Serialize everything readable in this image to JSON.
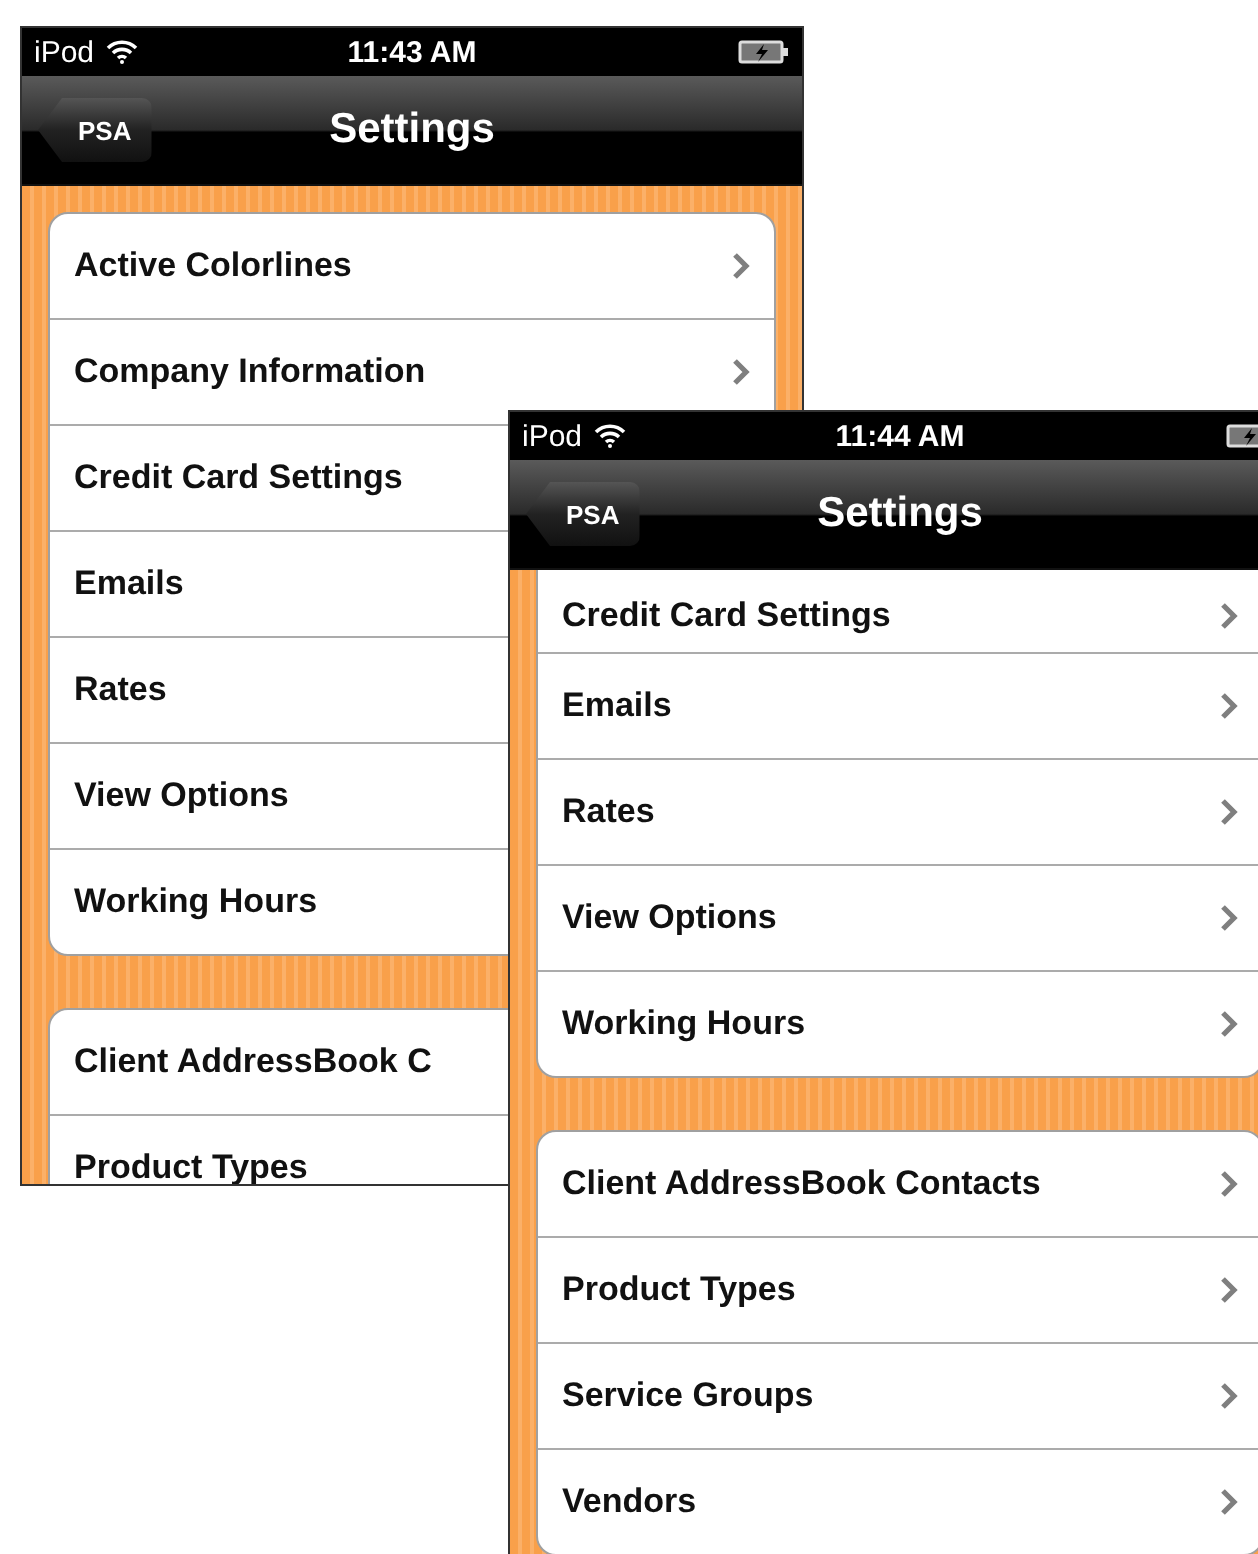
{
  "screens": [
    {
      "status_bar": {
        "carrier": "iPod",
        "time": "11:43 AM"
      },
      "nav_bar": {
        "back": "PSA",
        "title": "Settings"
      },
      "groups": [
        {
          "rows": [
            {
              "label": "Active Colorlines",
              "chevron": true
            },
            {
              "label": "Company Information",
              "chevron": true
            },
            {
              "label": "Credit Card Settings",
              "chevron": false
            },
            {
              "label": "Emails",
              "chevron": false
            },
            {
              "label": "Rates",
              "chevron": false
            },
            {
              "label": "View Options",
              "chevron": false
            },
            {
              "label": "Working Hours",
              "chevron": false
            }
          ]
        },
        {
          "rows": [
            {
              "label": "Client AddressBook C",
              "chevron": false
            },
            {
              "label": "Product Types",
              "chevron": false
            }
          ]
        }
      ]
    },
    {
      "status_bar": {
        "carrier": "iPod",
        "time": "11:44 AM"
      },
      "nav_bar": {
        "back": "PSA",
        "title": "Settings"
      },
      "groups": [
        {
          "rows": [
            {
              "label": "Credit Card Settings",
              "chevron": true
            },
            {
              "label": "Emails",
              "chevron": true
            },
            {
              "label": "Rates",
              "chevron": true
            },
            {
              "label": "View Options",
              "chevron": true
            },
            {
              "label": "Working Hours",
              "chevron": true
            }
          ]
        },
        {
          "rows": [
            {
              "label": "Client AddressBook Contacts",
              "chevron": true
            },
            {
              "label": "Product Types",
              "chevron": true
            },
            {
              "label": "Service Groups",
              "chevron": true
            },
            {
              "label": "Vendors",
              "chevron": true
            }
          ]
        }
      ]
    }
  ]
}
